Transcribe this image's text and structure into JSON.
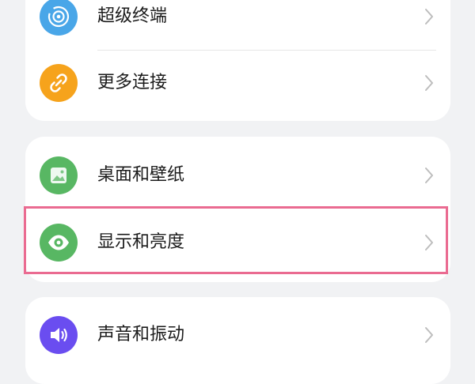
{
  "settings": {
    "group1": {
      "items": [
        {
          "label": "超级终端",
          "icon": "super-device-icon",
          "icon_color": "#49a6e8"
        },
        {
          "label": "更多连接",
          "icon": "link-icon",
          "icon_color": "#f6a31c"
        }
      ]
    },
    "group2": {
      "items": [
        {
          "label": "桌面和壁纸",
          "icon": "wallpaper-icon",
          "icon_color": "#58b763"
        },
        {
          "label": "显示和亮度",
          "icon": "eye-icon",
          "icon_color": "#58b763"
        }
      ]
    },
    "group3": {
      "items": [
        {
          "label": "声音和振动",
          "icon": "speaker-icon",
          "icon_color": "#6a4df0"
        }
      ]
    }
  },
  "highlight": {
    "target": "显示和亮度",
    "color": "#ea6b91"
  },
  "colors": {
    "background": "#f1f2f4",
    "card": "#ffffff",
    "text": "#1b1b1b",
    "chevron": "#bdbdbd"
  }
}
